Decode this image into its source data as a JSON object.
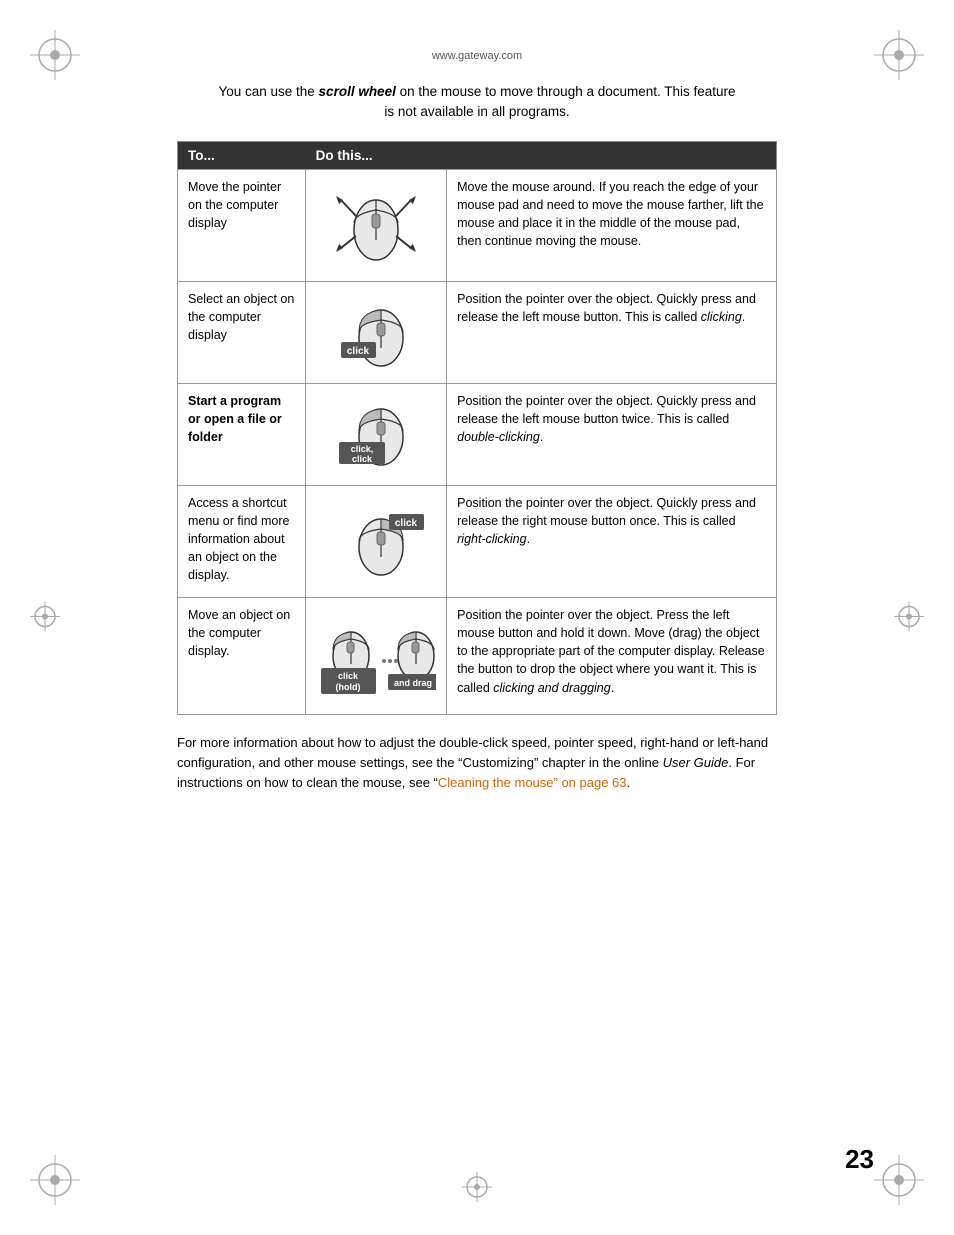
{
  "page": {
    "website": "www.gateway.com",
    "page_number": "23",
    "intro": {
      "text": "You can use the ",
      "italic_bold": "scroll wheel",
      "text2": " on the mouse to move through a document. This feature is not available in all programs."
    },
    "table": {
      "headers": {
        "col1": "To...",
        "col2": "Do this...",
        "col3": ""
      },
      "rows": [
        {
          "to": "Move the pointer on the computer display",
          "image_type": "mouse_move",
          "description": "Move the mouse around. If you reach the edge of your mouse pad and need to move the mouse farther, lift the mouse and place it in the middle of the mouse pad, then continue moving the mouse."
        },
        {
          "to": "Select an object on the computer display",
          "image_type": "mouse_click",
          "image_label": "click",
          "description": "Position the pointer over the object. Quickly press and release the left mouse button. This is called ",
          "italic": "clicking",
          "description2": "."
        },
        {
          "to": "Start a program or open a file or folder",
          "image_type": "mouse_double_click",
          "image_label": "click, click",
          "description": "Position the pointer over the object. Quickly press and release the left mouse button twice. This is called ",
          "italic": "double-clicking",
          "description2": "."
        },
        {
          "to": "Access a shortcut menu or find more information about an object on the display.",
          "image_type": "mouse_right_click",
          "image_label": "click",
          "description": "Position the pointer over the object. Quickly press and release the right mouse button once. This is called ",
          "italic": "right-clicking",
          "description2": "."
        },
        {
          "to": "Move an object on the computer display.",
          "image_type": "mouse_drag",
          "image_label1": "click (hold)",
          "image_label2": "and drag",
          "description": "Position the pointer over the object. Press the left mouse button and hold it down. Move (drag) the object to the appropriate part of the computer display. Release the button to drop the object where you want it. This is called ",
          "italic": "clicking and dragging",
          "description2": "."
        }
      ]
    },
    "footer": {
      "text1": "For more information about how to adjust the double-click speed, pointer speed, right-hand or left-hand configuration, and other mouse settings, see the “Customizing” chapter in the online ",
      "italic": "User Guide",
      "text2": ". For instructions on how to clean the mouse, see “",
      "link_text": "Cleaning the mouse” on page 63",
      "text3": "."
    }
  }
}
